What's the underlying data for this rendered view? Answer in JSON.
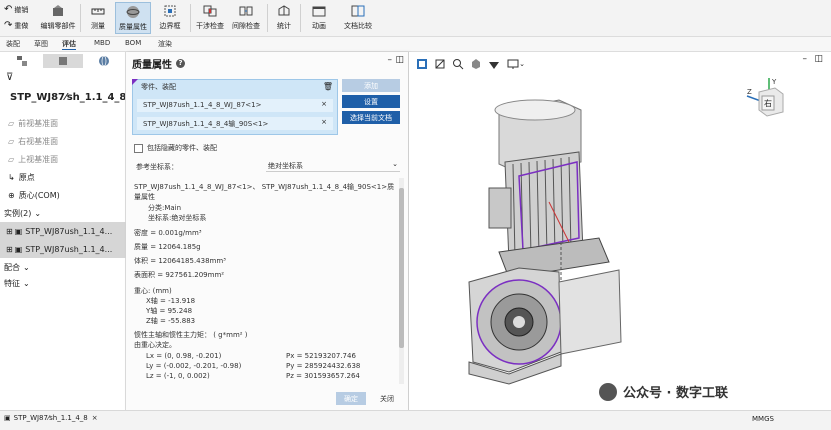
{
  "toolbar": {
    "undo_label": "撤销",
    "redo_label": "重做",
    "buttons": [
      {
        "label": "编辑零部件",
        "icon": "edit-part-icon"
      },
      {
        "label": "测量",
        "icon": "ruler-icon"
      },
      {
        "label": "质量属性",
        "icon": "mass-properties-icon"
      },
      {
        "label": "边界框",
        "icon": "bounding-box-icon"
      },
      {
        "label": "干涉检查",
        "icon": "interference-icon"
      },
      {
        "label": "间隙检查",
        "icon": "clearance-icon"
      },
      {
        "label": "统计",
        "icon": "statistics-icon"
      },
      {
        "label": "动画",
        "icon": "animation-icon"
      },
      {
        "label": "文档比较",
        "icon": "document-compare-icon"
      }
    ]
  },
  "command_tabs": [
    "装配",
    "草图",
    "评估",
    "MBD",
    "BOM",
    "渲染"
  ],
  "feature_tree": {
    "root": "STP_WJ87⁄sh_1.1_4_8",
    "items": [
      {
        "label": "前视基准面",
        "icon": "plane-icon",
        "style": "grey"
      },
      {
        "label": "右视基准面",
        "icon": "plane-icon",
        "style": "grey"
      },
      {
        "label": "上视基准面",
        "icon": "plane-icon",
        "style": "grey"
      },
      {
        "label": "原点",
        "icon": "origin-icon",
        "style": "normal"
      },
      {
        "label": "质心(COM)",
        "icon": "center-of-mass-icon",
        "style": "normal"
      }
    ],
    "instances_label": "实例(2)",
    "instances": [
      "STP_WJ87ush_1.1_4...",
      "STP_WJ87ush_1.1_4..."
    ],
    "mates_label": "配合",
    "features_label": "特征"
  },
  "dialog": {
    "title": "质量属性",
    "selection_label": "零件、装配",
    "selected": [
      "STP_WJ87ush_1.1_4_8_WJ_87<1>",
      "STP_WJ87ush_1.1_4_8_4输_90S<1>"
    ],
    "btn_add": "添加",
    "btn_settings": "设置",
    "btn_select_doc": "选择当前文档",
    "checkbox_hidden": "包括隐藏的零件、装配",
    "coord_label": "参考坐标系：",
    "coord_value": "绝对坐标系",
    "header_line": "STP_WJ87ush_1.1_4_8_WJ_87<1>、 STP_WJ87ush_1.1_4_8_4输_90S<1>质量属性",
    "lines": [
      "分类:Main",
      "坐标系:绝对坐标系",
      "密度 = 0.001g/mm³",
      "质量 = 12064.185g",
      "体积 = 12064185.438mm³",
      "表面积 = 927561.209mm²",
      "重心: (mm)",
      "X轴 = -13.918",
      "Y轴 = 95.248",
      "Z轴 = -55.883",
      "惯性主轴和惯性主力矩： ( g*mm² )",
      "由重心决定。",
      "Lx = (0, 0.98, -0.201)",
      "Ly = (-0.002, -0.201, -0.98)",
      "Lz = (-1, 0, 0.002)",
      "Px = 52193207.746",
      "Py = 285924432.638",
      "Pz = 301593657.264"
    ],
    "btn_ok": "确定",
    "btn_close": "关闭"
  },
  "status": {
    "doc_tab": "STP_WJ87⁄sh_1.1_4_8",
    "units": "MMGS"
  },
  "viewcube": {
    "face_label": "右"
  },
  "watermark": "公众号 · 数字工联",
  "accent_color": "#1f5fa8",
  "active_tool_color": "#cfe1f1",
  "selection_bg": "#cfe6f7",
  "highlight_color": "#7b2fc2"
}
